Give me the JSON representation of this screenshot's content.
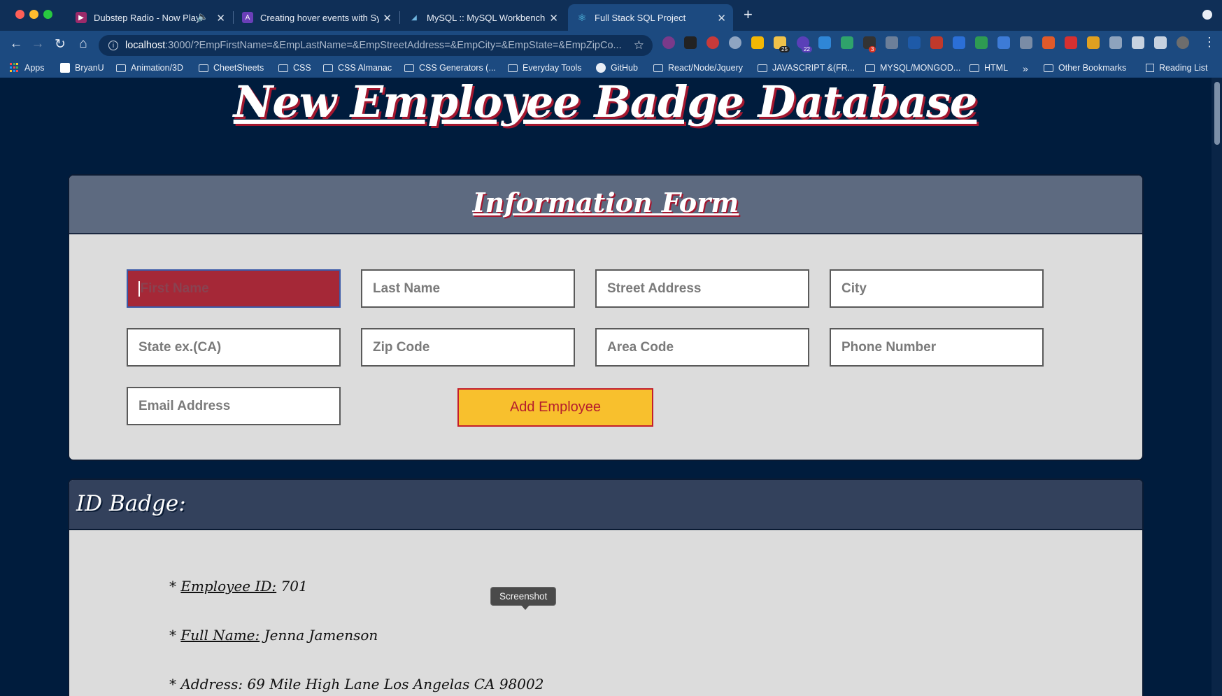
{
  "tabs": [
    {
      "title": "Dubstep Radio - Now Playi",
      "icon": "radio-icon",
      "color": "#9c2a6a"
    },
    {
      "title": "Creating hover events with Syn",
      "icon": "rocket-icon",
      "color": "#6a3fb8"
    },
    {
      "title": "MySQL :: MySQL Workbench M",
      "icon": "dolphin-icon",
      "color": "#2b6c9a"
    },
    {
      "title": "Full Stack SQL Project",
      "icon": "react-icon",
      "color": "#61dafb"
    }
  ],
  "address_bar": {
    "host": "localhost",
    "rest": ":3000/?EmpFirstName=&EmpLastName=&EmpStreetAddress=&EmpCity=&EmpState=&EmpZipCo..."
  },
  "extension_badges": {
    "a": "25",
    "b": "22",
    "c": "3"
  },
  "bookmarks": [
    {
      "label": "Apps",
      "icon": "apps-icon"
    },
    {
      "label": "BryanU",
      "icon": "bookmark-icon"
    },
    {
      "label": "Animation/3D",
      "icon": "folder-icon"
    },
    {
      "label": "CheetSheets",
      "icon": "folder-icon"
    },
    {
      "label": "CSS",
      "icon": "folder-icon"
    },
    {
      "label": "CSS Almanac",
      "icon": "folder-icon"
    },
    {
      "label": "CSS Generators (...",
      "icon": "folder-icon"
    },
    {
      "label": "Everyday  Tools",
      "icon": "folder-icon"
    },
    {
      "label": "GitHub",
      "icon": "github-icon"
    },
    {
      "label": "React/Node/Jquery",
      "icon": "folder-icon"
    },
    {
      "label": "JAVASCRIPT &(FR...",
      "icon": "folder-icon"
    },
    {
      "label": "MYSQL/MONGOD...",
      "icon": "folder-icon"
    },
    {
      "label": "HTML",
      "icon": "folder-icon"
    },
    {
      "label": "»",
      "icon": "chevron-icon"
    },
    {
      "label": "Other Bookmarks",
      "icon": "folder-icon"
    },
    {
      "label": "Reading List",
      "icon": "reading-list-icon"
    }
  ],
  "page": {
    "title": "New Employee Badge Database",
    "form_heading": "Information Form",
    "fields": {
      "first_name": "First Name",
      "last_name": "Last Name",
      "street": "Street Address",
      "city": "City",
      "state": "State ex.(CA)",
      "zip": "Zip Code",
      "area": "Area Code",
      "phone": "Phone Number",
      "email": "Email Address"
    },
    "add_button": "Add Employee",
    "badge_heading": "ID Badge:",
    "badge": {
      "id_label": "Employee ID:",
      "id_value": "701",
      "name_label": "Full Name:",
      "name_value": "Jenna Jamenson",
      "address_label": "Address:",
      "address_value": "69 Mile High Lane Los Angelas CA 98002",
      "bullet": "*"
    }
  },
  "tooltip": "Screenshot",
  "colors": {
    "accent_red": "#a52837",
    "button_yellow": "#f8c02d",
    "page_bg": "#001c3d"
  }
}
